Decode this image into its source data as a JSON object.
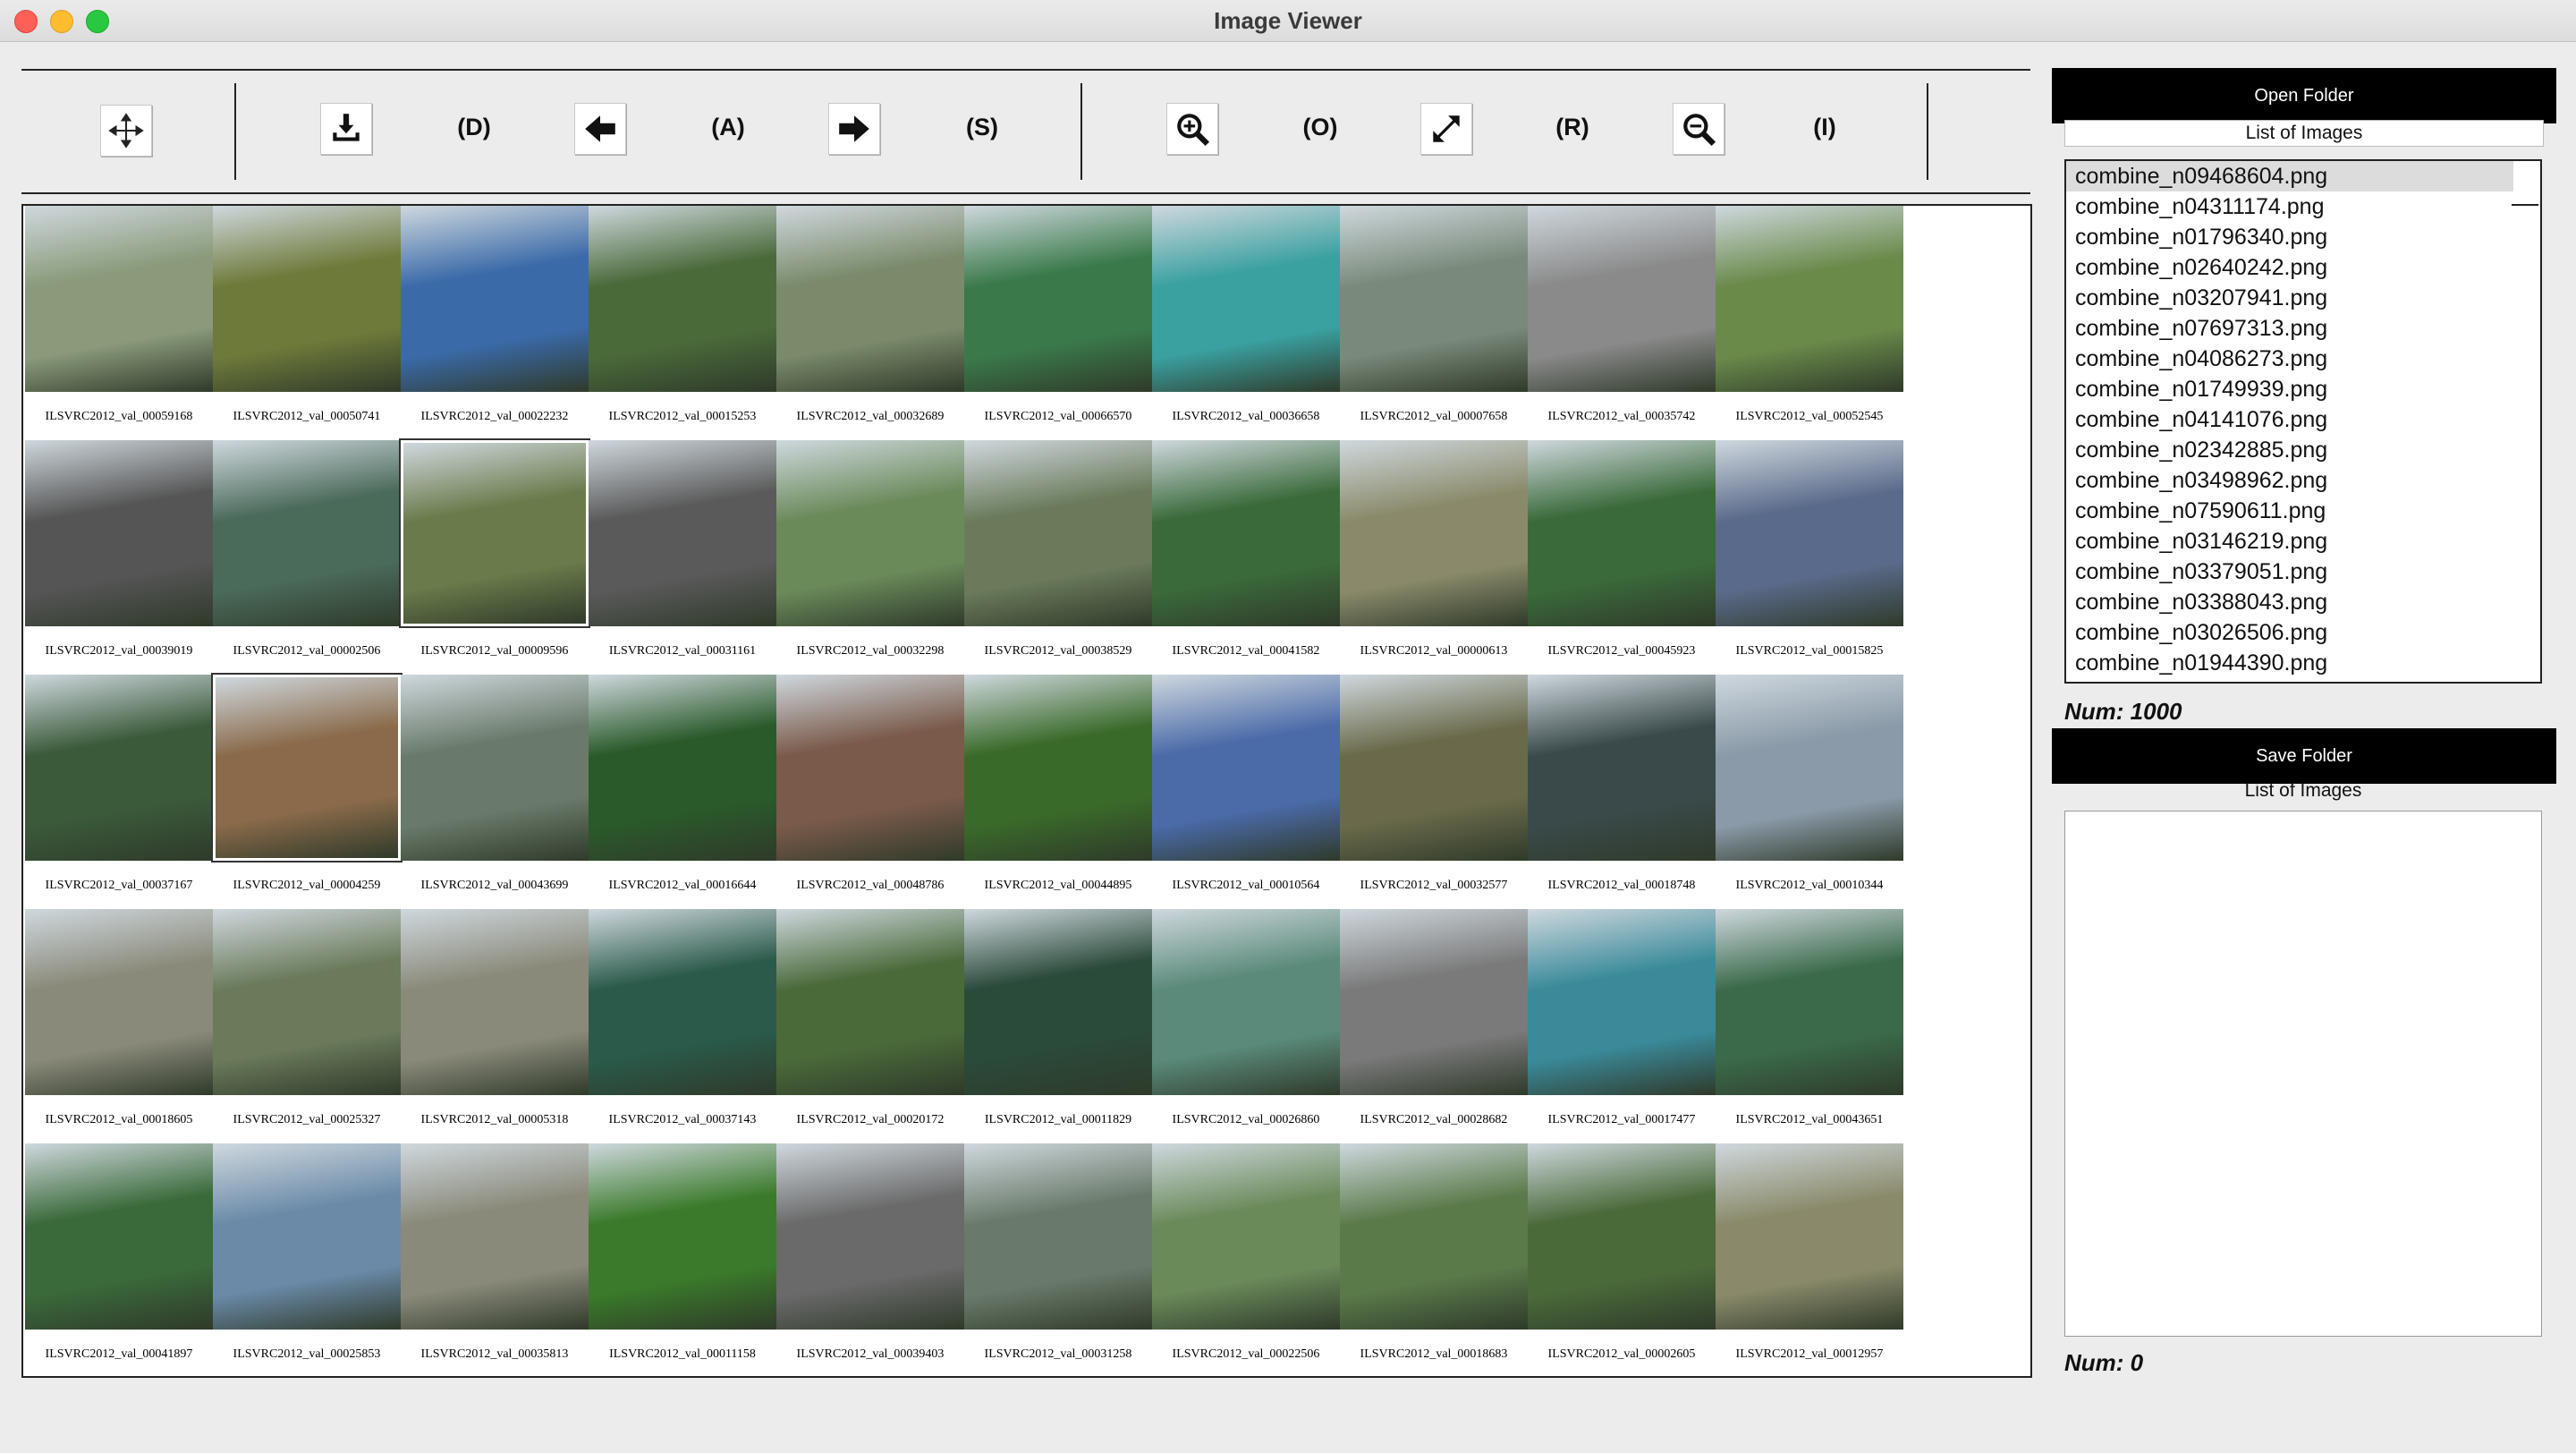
{
  "window": {
    "title": "Image Viewer"
  },
  "toolbar": {
    "keys": {
      "download": "(D)",
      "prev": "(A)",
      "next": "(S)",
      "zoom_in": "(O)",
      "fit": "(R)",
      "zoom_out": "(I)"
    }
  },
  "gallery": {
    "rows": [
      [
        "ILSVRC2012_val_00059168",
        "ILSVRC2012_val_00050741",
        "ILSVRC2012_val_00022232",
        "ILSVRC2012_val_00015253",
        "ILSVRC2012_val_00032689",
        "ILSVRC2012_val_00066570",
        "ILSVRC2012_val_00036658",
        "ILSVRC2012_val_00007658",
        "ILSVRC2012_val_00035742",
        "ILSVRC2012_val_00052545"
      ],
      [
        "ILSVRC2012_val_00039019",
        "ILSVRC2012_val_00002506",
        "ILSVRC2012_val_00009596",
        "ILSVRC2012_val_00031161",
        "ILSVRC2012_val_00032298",
        "ILSVRC2012_val_00038529",
        "ILSVRC2012_val_00041582",
        "ILSVRC2012_val_00000613",
        "ILSVRC2012_val_00045923",
        "ILSVRC2012_val_00015825"
      ],
      [
        "ILSVRC2012_val_00037167",
        "ILSVRC2012_val_00004259",
        "ILSVRC2012_val_00043699",
        "ILSVRC2012_val_00016644",
        "ILSVRC2012_val_00048786",
        "ILSVRC2012_val_00044895",
        "ILSVRC2012_val_00010564",
        "ILSVRC2012_val_00032577",
        "ILSVRC2012_val_00018748",
        "ILSVRC2012_val_00010344"
      ],
      [
        "ILSVRC2012_val_00018605",
        "ILSVRC2012_val_00025327",
        "ILSVRC2012_val_00005318",
        "ILSVRC2012_val_00037143",
        "ILSVRC2012_val_00020172",
        "ILSVRC2012_val_00011829",
        "ILSVRC2012_val_00026860",
        "ILSVRC2012_val_00028682",
        "ILSVRC2012_val_00017477",
        "ILSVRC2012_val_00043651"
      ],
      [
        "ILSVRC2012_val_00041897",
        "ILSVRC2012_val_00025853",
        "ILSVRC2012_val_00035813",
        "ILSVRC2012_val_00011158",
        "ILSVRC2012_val_00039403",
        "ILSVRC2012_val_00031258",
        "ILSVRC2012_val_00022506",
        "ILSVRC2012_val_00018683",
        "ILSVRC2012_val_00002605",
        "ILSVRC2012_val_00012957"
      ]
    ],
    "palettes": [
      [
        "#8a9a7a",
        "#6e7a3a",
        "#3a6aa8",
        "#4a6a3a",
        "#7a8a6a",
        "#3a7a4a",
        "#3aa0a0",
        "#7a8a7a",
        "#8a8a8a",
        "#6a8a4a"
      ],
      [
        "#555555",
        "#4a6a5a",
        "#6a7a4a",
        "#5a5a5a",
        "#6a8a5a",
        "#6a7a5a",
        "#3a6a3a",
        "#8a8a6a",
        "#3a6a3a",
        "#5a6a8a"
      ],
      [
        "#3a5a3a",
        "#8a6a4a",
        "#6a7a6a",
        "#2a5a2a",
        "#7a5a4a",
        "#3a6a2a",
        "#4a6aa8",
        "#6a6a4a",
        "#3a4a4a",
        "#8a9aa8"
      ],
      [
        "#8a8a7a",
        "#6a7a5a",
        "#8a8a7a",
        "#2a5a4a",
        "#4a6a3a",
        "#2a4a3a",
        "#5a8a7a",
        "#7a7a7a",
        "#3a8a9a",
        "#3a6a4a"
      ],
      [
        "#3a6a3a",
        "#6a8aa8",
        "#8a8a7a",
        "#3a7a2a",
        "#6a6a6a",
        "#6a7a6a",
        "#6a8a5a",
        "#5a7a4a",
        "#4a6a3a",
        "#8a8a6a"
      ]
    ],
    "selected": [
      [
        1,
        2
      ],
      [
        2,
        1
      ]
    ]
  },
  "sidebar": {
    "open_label": "Open Folder",
    "list_header": "List of Images",
    "files": [
      "combine_n09468604.png",
      "combine_n04311174.png",
      "combine_n01796340.png",
      "combine_n02640242.png",
      "combine_n03207941.png",
      "combine_n07697313.png",
      "combine_n04086273.png",
      "combine_n01749939.png",
      "combine_n04141076.png",
      "combine_n02342885.png",
      "combine_n03498962.png",
      "combine_n07590611.png",
      "combine_n03146219.png",
      "combine_n03379051.png",
      "combine_n03388043.png",
      "combine_n03026506.png",
      "combine_n01944390.png"
    ],
    "count_label": "Num: 1000",
    "save_label": "Save Folder",
    "save_list_header": "List of Images",
    "save_count_label": "Num: 0"
  }
}
